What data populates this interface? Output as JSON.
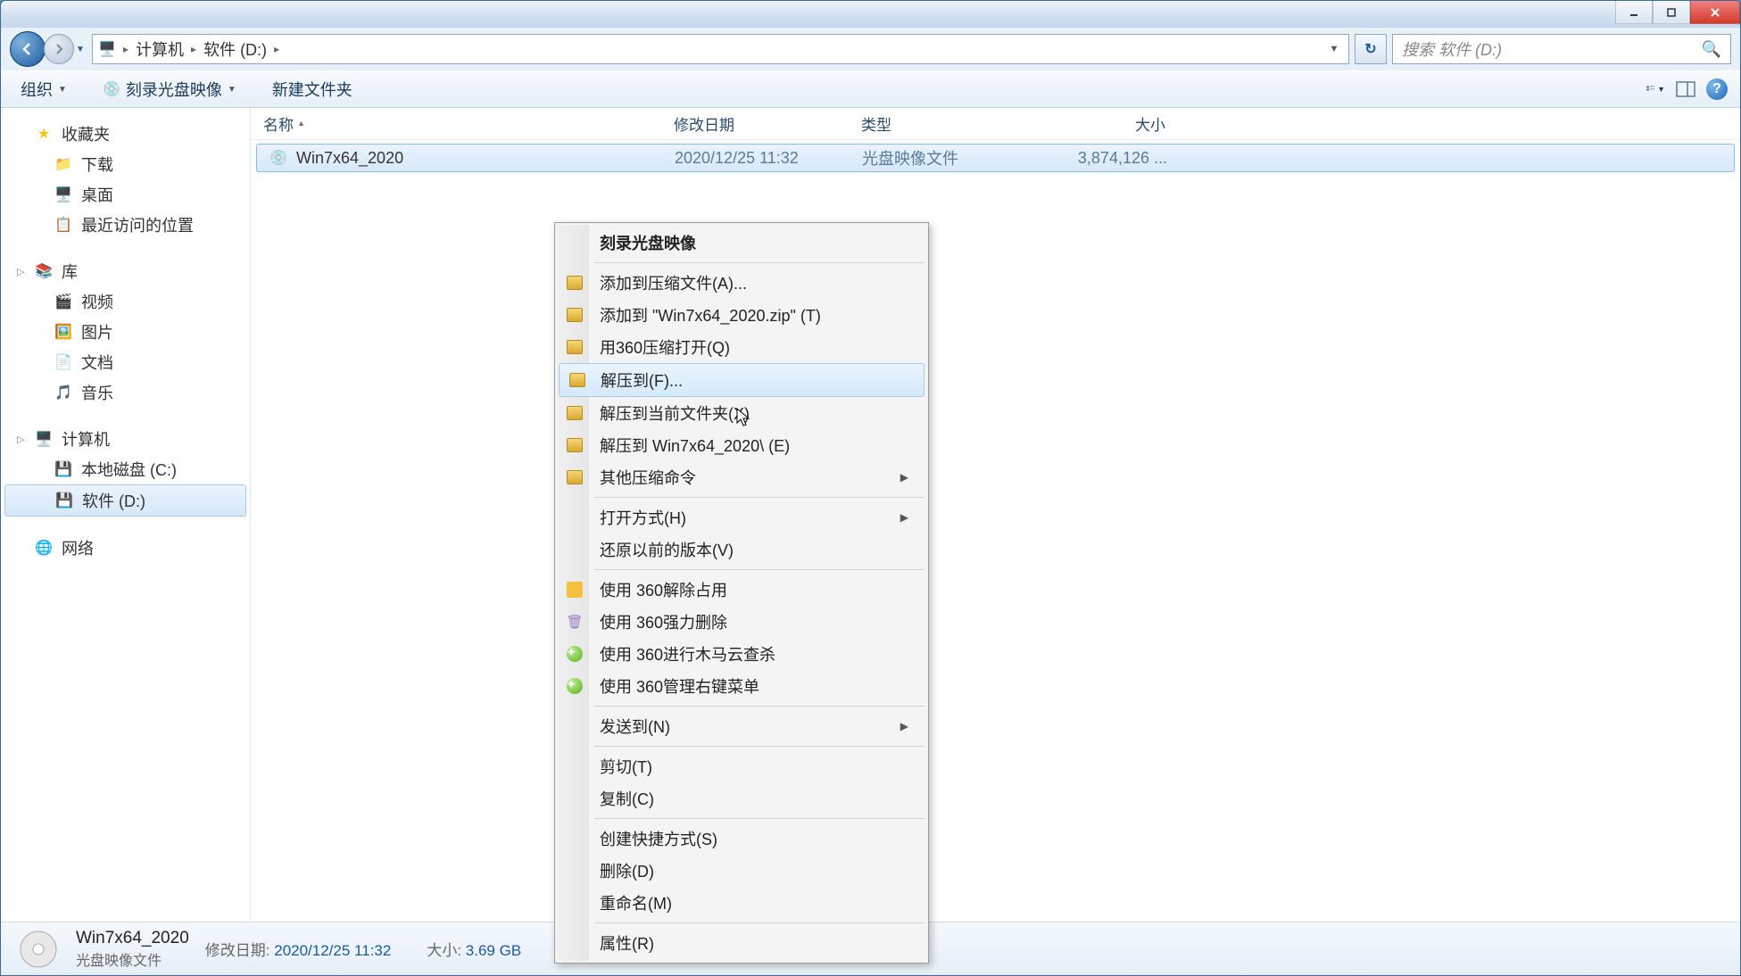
{
  "titlebar": {},
  "nav": {
    "crumbs": [
      "计算机",
      "软件 (D:)"
    ],
    "search_placeholder": "搜索 软件 (D:)"
  },
  "toolbar": {
    "organize": "组织",
    "burn": "刻录光盘映像",
    "newfolder": "新建文件夹"
  },
  "sidebar": {
    "favorites": {
      "label": "收藏夹",
      "items": [
        "下载",
        "桌面",
        "最近访问的位置"
      ]
    },
    "libraries": {
      "label": "库",
      "items": [
        "视频",
        "图片",
        "文档",
        "音乐"
      ]
    },
    "computer": {
      "label": "计算机",
      "items": [
        "本地磁盘 (C:)",
        "软件 (D:)"
      ]
    },
    "network": {
      "label": "网络"
    }
  },
  "columns": {
    "name": "名称",
    "date": "修改日期",
    "type": "类型",
    "size": "大小"
  },
  "files": [
    {
      "name": "Win7x64_2020",
      "date": "2020/12/25 11:32",
      "type": "光盘映像文件",
      "size": "3,874,126 ..."
    }
  ],
  "context": {
    "burn": "刻录光盘映像",
    "add_archive": "添加到压缩文件(A)...",
    "add_zip": "添加到 \"Win7x64_2020.zip\" (T)",
    "open_360zip": "用360压缩打开(Q)",
    "extract_to": "解压到(F)...",
    "extract_here": "解压到当前文件夹(X)",
    "extract_named": "解压到 Win7x64_2020\\ (E)",
    "other_zip": "其他压缩命令",
    "open_with": "打开方式(H)",
    "restore_prev": "还原以前的版本(V)",
    "use_360_unlock": "使用 360解除占用",
    "use_360_forcedel": "使用 360强力删除",
    "use_360_scan": "使用 360进行木马云查杀",
    "use_360_ctxmgr": "使用 360管理右键菜单",
    "send_to": "发送到(N)",
    "cut": "剪切(T)",
    "copy": "复制(C)",
    "shortcut": "创建快捷方式(S)",
    "delete": "删除(D)",
    "rename": "重命名(M)",
    "properties": "属性(R)"
  },
  "details": {
    "name": "Win7x64_2020",
    "type": "光盘映像文件",
    "date_label": "修改日期:",
    "date": "2020/12/25 11:32",
    "size_label": "大小:",
    "size": "3.69 GB"
  }
}
